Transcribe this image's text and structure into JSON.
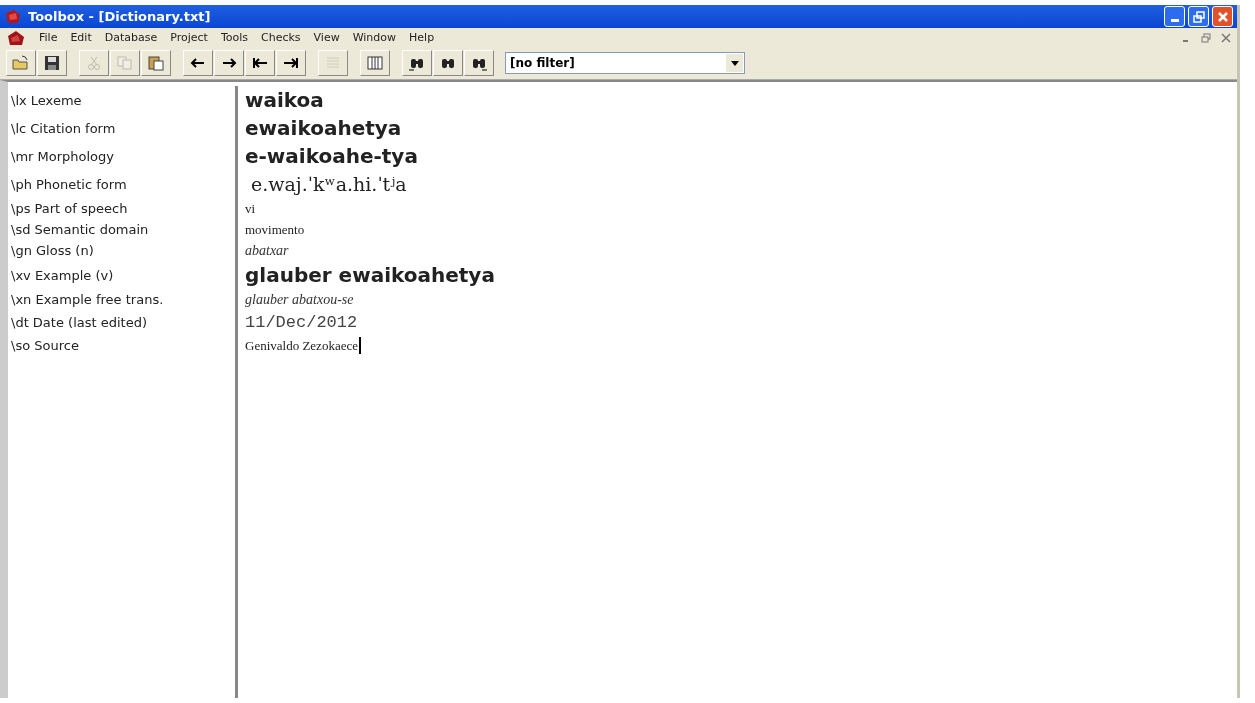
{
  "window": {
    "title": "Toolbox - [Dictionary.txt]"
  },
  "menu": [
    "File",
    "Edit",
    "Database",
    "Project",
    "Tools",
    "Checks",
    "View",
    "Window",
    "Help"
  ],
  "toolbar": [
    {
      "kind": "open",
      "disabled": false
    },
    {
      "kind": "save",
      "disabled": false
    },
    {
      "kind": "sep"
    },
    {
      "kind": "cut",
      "disabled": true
    },
    {
      "kind": "copy",
      "disabled": true
    },
    {
      "kind": "paste",
      "disabled": false
    },
    {
      "kind": "sep"
    },
    {
      "kind": "back",
      "disabled": false
    },
    {
      "kind": "forward",
      "disabled": false
    },
    {
      "kind": "first",
      "disabled": false
    },
    {
      "kind": "last",
      "disabled": false
    },
    {
      "kind": "sep"
    },
    {
      "kind": "lines",
      "disabled": true
    },
    {
      "kind": "sep"
    },
    {
      "kind": "columns",
      "disabled": false
    },
    {
      "kind": "sep"
    },
    {
      "kind": "find-prev",
      "disabled": false
    },
    {
      "kind": "find",
      "disabled": false
    },
    {
      "kind": "find-next",
      "disabled": false
    }
  ],
  "filter": {
    "value": "[no filter]"
  },
  "fields": [
    {
      "marker": "\\lx",
      "label": "Lexeme",
      "value": "waikoa",
      "kind": "bold"
    },
    {
      "marker": "\\lc",
      "label": "Citation form",
      "value": "ewaikoahetya",
      "kind": "bold"
    },
    {
      "marker": "\\mr",
      "label": "Morphology",
      "value": "e-waikoahe-tya",
      "kind": "bold"
    },
    {
      "marker": "\\ph",
      "label": "Phonetic form",
      "value": "e.waj.ˈkʷa.hi.ˈtʲa",
      "kind": "phonetic"
    },
    {
      "marker": "\\ps",
      "label": "Part of speech",
      "value": "vi",
      "kind": "serif"
    },
    {
      "marker": "\\sd",
      "label": "Semantic domain",
      "value": "movimento",
      "kind": "serif"
    },
    {
      "marker": "\\gn",
      "label": "Gloss (n)",
      "value": "abatxar",
      "kind": "italic"
    },
    {
      "marker": "\\xv",
      "label": "Example (v)",
      "value": "glauber ewaikoahetya",
      "kind": "bold"
    },
    {
      "marker": "\\xn",
      "label": "Example free trans.",
      "value": "glauber abatxou-se",
      "kind": "italic"
    },
    {
      "marker": "\\dt",
      "label": "Date (last edited)",
      "value": "11/Dec/2012",
      "kind": "mono"
    },
    {
      "marker": "\\so",
      "label": "Source",
      "value": "Genivaldo Zezokaece",
      "kind": "serif",
      "cursor": true
    }
  ]
}
